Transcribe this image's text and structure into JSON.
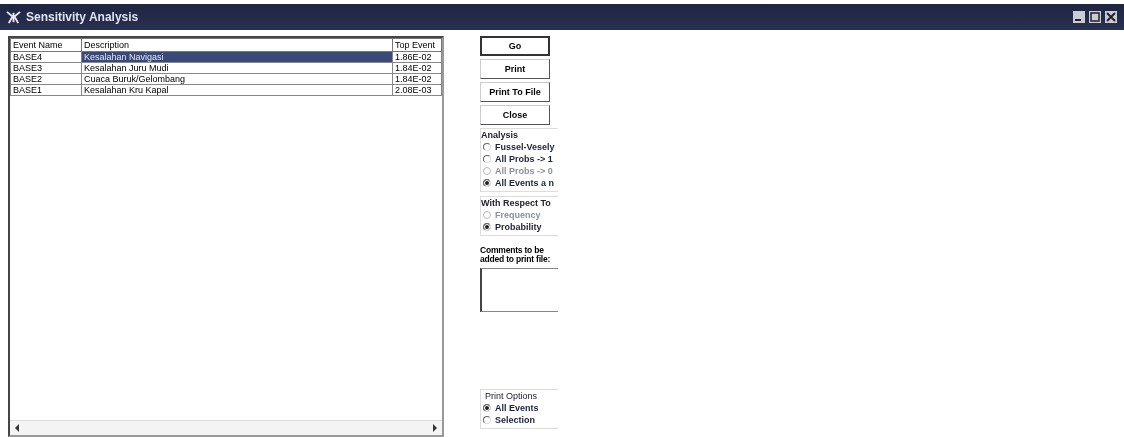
{
  "window": {
    "title": "Sensitivity Analysis"
  },
  "table": {
    "columns": [
      "Event Name",
      "Description",
      "Top Event"
    ],
    "rows": [
      {
        "cells": [
          "BASE4",
          "Kesalahan Navigasi",
          "1.86E-02"
        ],
        "selected": true
      },
      {
        "cells": [
          "BASE3",
          "Kesalahan Juru Mudi",
          "1.84E-02"
        ],
        "selected": false
      },
      {
        "cells": [
          "BASE2",
          "Cuaca Buruk/Gelombang",
          "1.84E-02"
        ],
        "selected": false
      },
      {
        "cells": [
          "BASE1",
          "Kesalahan Kru Kapal",
          "2.08E-03"
        ],
        "selected": false
      }
    ]
  },
  "buttons": [
    {
      "label": "Go",
      "default": true
    },
    {
      "label": "Print",
      "default": false
    },
    {
      "label": "Print To File",
      "default": false
    },
    {
      "label": "Close",
      "default": false
    }
  ],
  "analysis": {
    "title": "Analysis",
    "options": [
      {
        "label": "Fussel-Vesely",
        "selected": false,
        "disabled": false
      },
      {
        "label": "All Probs -> 1",
        "selected": false,
        "disabled": false
      },
      {
        "label": "All Probs -> 0",
        "selected": false,
        "disabled": true
      },
      {
        "label": "All Events a n",
        "selected": true,
        "disabled": false
      }
    ]
  },
  "with_respect_to": {
    "title": "With Respect To",
    "options": [
      {
        "label": "Frequency",
        "selected": false,
        "disabled": true
      },
      {
        "label": "Probability",
        "selected": true,
        "disabled": false
      }
    ]
  },
  "comments": {
    "label": "Comments to be added to print file:"
  },
  "print_options": {
    "title": "Print Options",
    "options": [
      {
        "label": "All Events",
        "selected": true,
        "disabled": false
      },
      {
        "label": "Selection",
        "selected": false,
        "disabled": false
      }
    ]
  }
}
